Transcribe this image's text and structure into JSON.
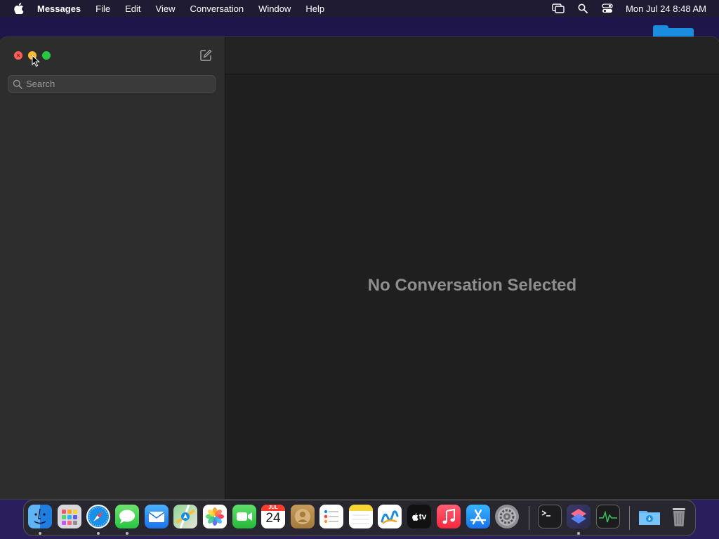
{
  "menubar": {
    "app_name": "Messages",
    "menus": [
      "File",
      "Edit",
      "View",
      "Conversation",
      "Window",
      "Help"
    ],
    "clock": "Mon Jul 24  8:48 AM",
    "status_icons": [
      "screen-mirroring-icon",
      "spotlight-search-icon",
      "control-center-icon"
    ]
  },
  "sidebar": {
    "search_placeholder": "Search"
  },
  "main": {
    "empty_title": "No Conversation Selected"
  },
  "dock": {
    "calendar_month": "JUL",
    "calendar_day": "24",
    "tv_label": "tv",
    "apps": [
      "Finder",
      "Launchpad",
      "Safari",
      "Messages",
      "Mail",
      "Maps",
      "Photos",
      "FaceTime",
      "Calendar",
      "Contacts",
      "Reminders",
      "Notes",
      "Freeform",
      "TV",
      "Music",
      "App Store",
      "System Settings",
      "Terminal",
      "Shortcuts",
      "Activity Monitor",
      "Downloads",
      "Trash"
    ]
  },
  "colors": {
    "close": "#ff5f57",
    "minimize": "#febc2e",
    "maximize": "#28c840",
    "accent": "#1a8de0"
  }
}
